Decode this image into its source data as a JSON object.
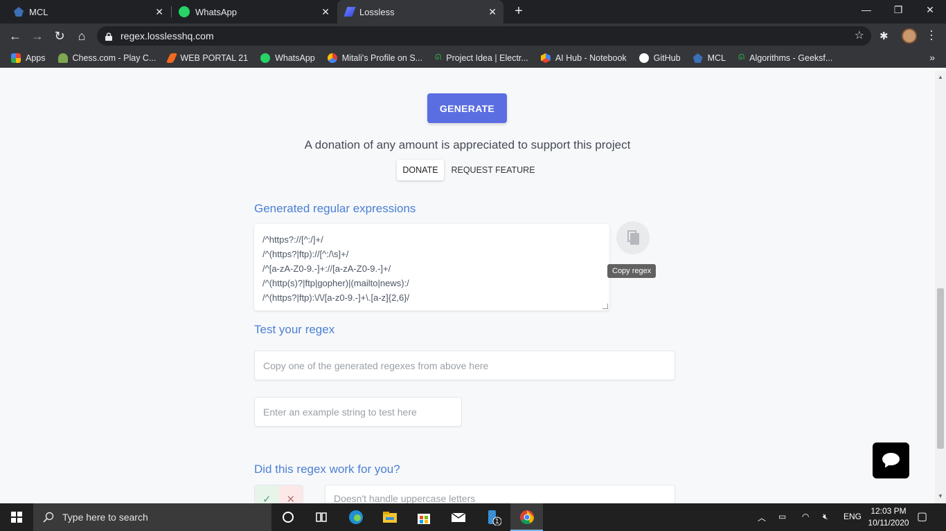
{
  "browser": {
    "tabs": [
      {
        "title": "MCL",
        "close": "✕"
      },
      {
        "title": "WhatsApp",
        "close": "✕"
      },
      {
        "title": "Lossless",
        "close": "✕"
      }
    ],
    "new_tab": "+",
    "url": "regex.losslesshq.com",
    "bookmarks": [
      {
        "label": "Apps",
        "color": "#e8453c"
      },
      {
        "label": "Chess.com - Play C...",
        "color": "#7fa650"
      },
      {
        "label": "WEB PORTAL 21",
        "color": "#f06a1f"
      },
      {
        "label": "WhatsApp",
        "color": "#25d366"
      },
      {
        "label": "Mitali's Profile on S...",
        "color": "#e0413a"
      },
      {
        "label": "Project Idea | Electr...",
        "color": "#2f8d46"
      },
      {
        "label": "AI Hub - Notebook",
        "color": "#4285f4"
      },
      {
        "label": "GitHub",
        "color": "#ffffff"
      },
      {
        "label": "MCL",
        "color": "#3b6fb6"
      },
      {
        "label": "Algorithms - Geeksf...",
        "color": "#2f8d46"
      }
    ],
    "bookmarks_more": "»"
  },
  "page": {
    "generate_label": "GENERATE",
    "donation_text": "A donation of any amount is appreciated to support this project",
    "donate_label": "DONATE",
    "request_label": "REQUEST FEATURE",
    "generated_heading": "Generated regular expressions",
    "regexes": [
      "/^https?://[^:/]+/",
      "/^(https?|ftp)://[^:/\\s]+/",
      "/^[a-zA-Z0-9.-]+://[a-zA-Z0-9.-]+/",
      "/^(http(s)?|ftp|gopher)|(mailto|news):/",
      "/^(https?|ftp):\\/\\/[a-z0-9.-]+\\.[a-z]{2,6}/"
    ],
    "copy_tooltip": "Copy regex",
    "test_heading": "Test your regex",
    "regex_input_placeholder": "Copy one of the generated regexes from above here",
    "example_input_placeholder": "Enter an example string to test here",
    "feedback_heading": "Did this regex work for you?",
    "yes_symbol": "✓",
    "no_symbol": "✕",
    "feedback_input_placeholder": "Doesn't handle uppercase letters"
  },
  "taskbar": {
    "search_placeholder": "Type here to search",
    "language": "ENG",
    "time": "12:03 PM",
    "date": "10/11/2020",
    "badge": "1"
  }
}
